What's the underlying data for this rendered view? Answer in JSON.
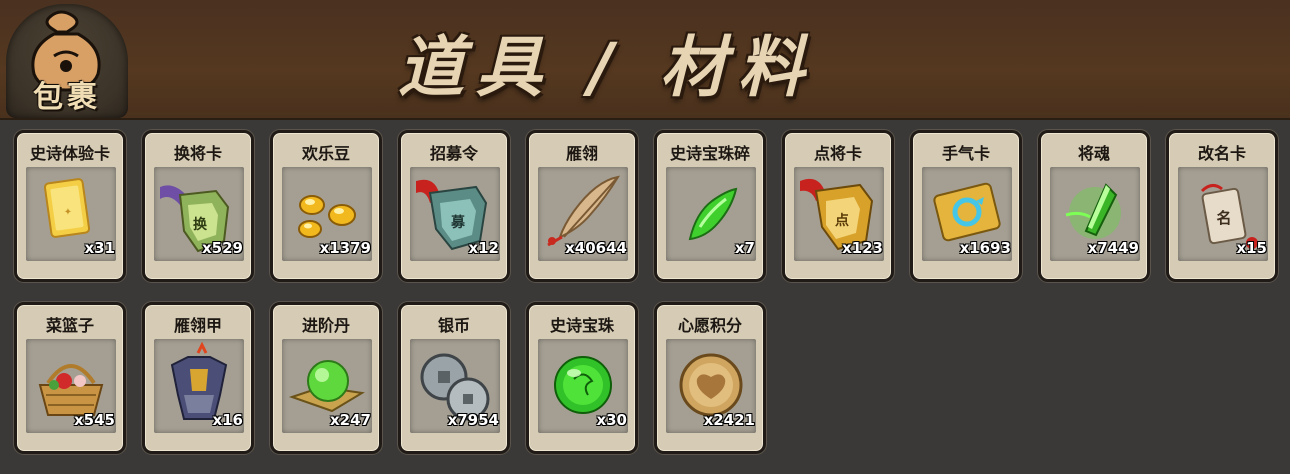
{
  "header": {
    "bag_label": "包裹",
    "title": "道具 / 材料"
  },
  "items": [
    {
      "name": "史诗体验卡",
      "count": "x31",
      "icon": "gold-card-icon"
    },
    {
      "name": "换将卡",
      "count": "x529",
      "icon": "swap-general-token-icon"
    },
    {
      "name": "欢乐豆",
      "count": "x1379",
      "icon": "golden-beans-icon"
    },
    {
      "name": "招募令",
      "count": "x12",
      "icon": "recruit-order-icon"
    },
    {
      "name": "雁翎",
      "count": "x40644",
      "icon": "feather-icon"
    },
    {
      "name": "史诗宝珠碎",
      "count": "x7",
      "icon": "green-shard-icon"
    },
    {
      "name": "点将卡",
      "count": "x123",
      "icon": "select-general-token-icon"
    },
    {
      "name": "手气卡",
      "count": "x1693",
      "icon": "luck-card-icon"
    },
    {
      "name": "将魂",
      "count": "x7449",
      "icon": "green-crystal-icon"
    },
    {
      "name": "改名卡",
      "count": "x15",
      "icon": "rename-tag-icon"
    },
    {
      "name": "菜篮子",
      "count": "x545",
      "icon": "flower-basket-icon"
    },
    {
      "name": "雁翎甲",
      "count": "x16",
      "icon": "armor-icon"
    },
    {
      "name": "进阶丹",
      "count": "x247",
      "icon": "green-pill-icon"
    },
    {
      "name": "银币",
      "count": "x7954",
      "icon": "silver-coins-icon"
    },
    {
      "name": "史诗宝珠",
      "count": "x30",
      "icon": "green-orb-icon"
    },
    {
      "name": "心愿积分",
      "count": "x2421",
      "icon": "heart-coin-icon"
    }
  ]
}
